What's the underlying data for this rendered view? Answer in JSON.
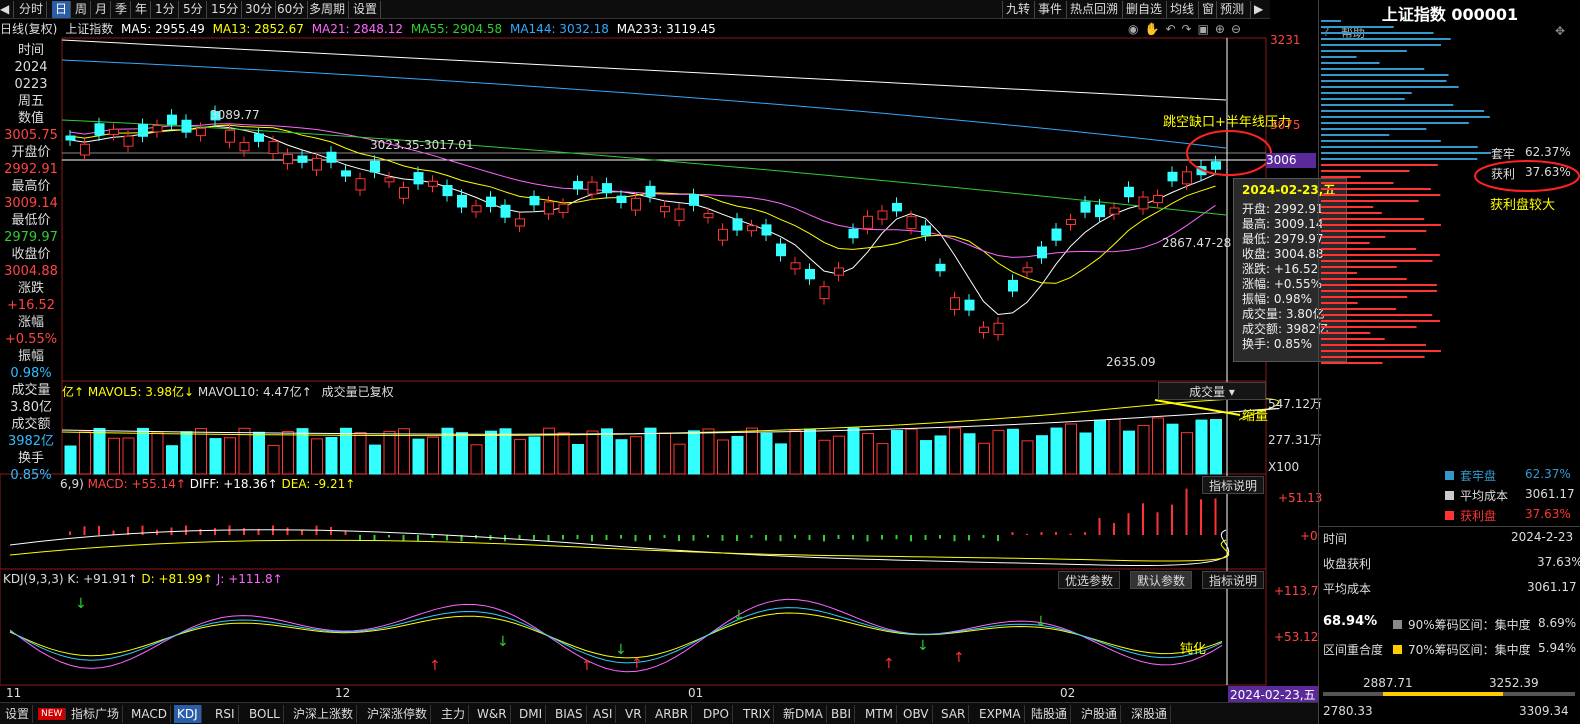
{
  "toolbar": {
    "left": [
      "分时",
      "日",
      "周",
      "月",
      "季",
      "年",
      "1分",
      "5分",
      "15分",
      "30分",
      "60分",
      "多周期",
      "设置"
    ],
    "active": "日",
    "right": [
      "九转",
      "事件",
      "热点回溯",
      "删自选",
      "均线",
      "窗",
      "预测"
    ]
  },
  "ma_line": {
    "period": "日线(复权)",
    "name": "上证指数",
    "items": [
      {
        "label": "MA5: 2955.49",
        "color": "#ffffff"
      },
      {
        "label": "MA13: 2852.67",
        "color": "#ffff00"
      },
      {
        "label": "MA21: 2848.12",
        "color": "#ff66ff"
      },
      {
        "label": "MA55: 2904.58",
        "color": "#33cc33"
      },
      {
        "label": "MA144: 3032.18",
        "color": "#33aaff"
      },
      {
        "label": "MA233: 3119.45",
        "color": "#ffffff"
      }
    ]
  },
  "info": {
    "time_label": "时间",
    "date1": "2024",
    "date2": "0223",
    "weekday": "周五",
    "value_label": "数值",
    "value": "3005.75",
    "open_label": "开盘价",
    "open": "2992.91",
    "high_label": "最高价",
    "high": "3009.14",
    "low_label": "最低价",
    "low": "2979.97",
    "close_label": "收盘价",
    "close": "3004.88",
    "chg_label": "涨跌",
    "chg": "+16.52",
    "pct_label": "涨幅",
    "pct": "+0.55%",
    "amp_label": "振幅",
    "amp": "0.98%",
    "vol_label": "成交量",
    "vol": "3.80亿",
    "amt_label": "成交额",
    "amt": "3982亿",
    "turn_label": "换手",
    "turn": "0.85%"
  },
  "price_axis": [
    "3231",
    "3075",
    "3006"
  ],
  "annotations": {
    "high_mark": "3089.77",
    "gap": "3023.35-3017.01",
    "low_mark": "2635.09",
    "right_mark": "2867.47-28",
    "pressure": "跳空缺口+半年线压力",
    "shrink": "缩量",
    "blunt": "钝化",
    "profit_big": "获利盘较大"
  },
  "tooltip": {
    "title": "2024-02-23,五",
    "rows": [
      "开盘: 2992.91",
      "最高: 3009.14",
      "最低: 2979.97",
      "收盘: 3004.88",
      "涨跌: +16.52",
      "涨幅: +0.55%",
      "振幅: 0.98%",
      "成交量: 3.80亿",
      "成交额: 3982亿",
      "换手: 0.85%"
    ]
  },
  "volume": {
    "header_left": "亿↑",
    "mavol5": "MAVOL5: 3.98亿↓",
    "mavol10": "MAVOL10: 4.47亿↑",
    "note": "成交量已复权",
    "selector": "成交量",
    "axis": [
      "547.12万",
      "277.31万",
      "X100"
    ]
  },
  "macd": {
    "header": "6,9)",
    "macd": "MACD: +55.14↑",
    "diff": "DIFF: +18.36↑",
    "dea": "DEA: -9.21↑",
    "button": "指标说明",
    "axis": [
      "+51.13",
      "+0"
    ]
  },
  "kdj": {
    "header": "KDJ(9,3,3)",
    "k": "K: +91.91↑",
    "d": "D: +81.99↑",
    "j": "J: +111.8↑",
    "buttons": [
      "优选参数",
      "默认参数",
      "指标说明"
    ],
    "axis": [
      "+113.7",
      "+53.12"
    ]
  },
  "time_axis": [
    "11",
    "12",
    "01",
    "02"
  ],
  "time_axis_end": "2024-02-23,五",
  "bottom_tabs": [
    "设置",
    "NEW",
    "指标广场",
    "MACD",
    "KDJ",
    "RSI",
    "BOLL",
    "沪深上涨数",
    "沪深涨停数",
    "主力",
    "W&R",
    "DMI",
    "BIAS",
    "ASI",
    "VR",
    "ARBR",
    "DPO",
    "TRIX",
    "新DMA",
    "BBI",
    "MTM",
    "OBV",
    "SAR",
    "EXPMA",
    "陆股通",
    "沪股通",
    "深股通"
  ],
  "bottom_active": "KDJ",
  "right_panel": {
    "title": "上证指数 000001",
    "help": "帮助",
    "trapped_label": "套牢",
    "trapped_pct": "62.37%",
    "profit_label": "获利",
    "profit_pct": "37.63%",
    "legend": [
      {
        "label": "套牢盘",
        "value": "62.37%",
        "color": "#3399cc"
      },
      {
        "label": "平均成本",
        "value": "3061.17",
        "color": "#cccccc"
      },
      {
        "label": "获利盘",
        "value": "37.63%",
        "color": "#ff3333"
      }
    ],
    "stats": [
      {
        "label": "时间",
        "value": "2024-2-23"
      },
      {
        "label": "收盘获利",
        "value": "37.63%"
      },
      {
        "label": "平均成本",
        "value": "3061.17"
      }
    ],
    "concentration": {
      "main": "68.94%",
      "sub": "区间重合度",
      "r90_label": "90%筹码区间：集中度",
      "r90": "8.69%",
      "r70_label": "70%筹码区间：集中度",
      "r70": "5.94%"
    },
    "range": [
      "2887.71",
      "3252.39",
      "2780.33",
      "3309.34"
    ]
  }
}
